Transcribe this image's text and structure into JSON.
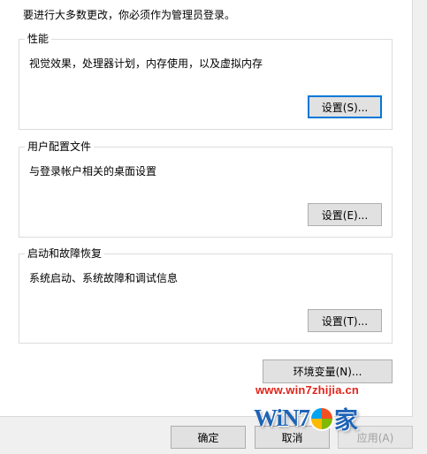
{
  "admin_note": "要进行大多数更改，你必须作为管理员登录。",
  "performance": {
    "title": "性能",
    "description": "视觉效果，处理器计划，内存使用，以及虚拟内存",
    "settings_label": "设置(S)..."
  },
  "user_profiles": {
    "title": "用户配置文件",
    "description": "与登录帐户相关的桌面设置",
    "settings_label": "设置(E)..."
  },
  "startup_recovery": {
    "title": "启动和故障恢复",
    "description": "系统启动、系统故障和调试信息",
    "settings_label": "设置(T)..."
  },
  "env_vars_label": "环境变量(N)...",
  "footer": {
    "ok_label": "确定",
    "cancel_label": "取消",
    "apply_label": "应用(A)"
  },
  "watermark": {
    "url": "www.win7zhijia.cn",
    "logo_prefix": "WiN7",
    "logo_suffix": "家"
  },
  "colors": {
    "focus_border": "#0078d7",
    "watermark_url": "#e2231a",
    "watermark_logo": "#1e63b6"
  }
}
